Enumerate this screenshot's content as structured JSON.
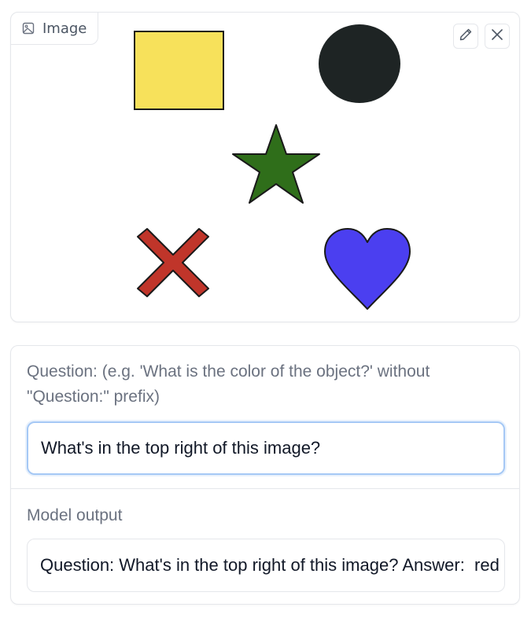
{
  "image_panel": {
    "badge_label": "Image",
    "badge_icon": "image-icon",
    "edit_icon": "pencil-icon",
    "close_icon": "close-icon",
    "shapes": [
      {
        "name": "yellow-square",
        "color": "#f7e15b"
      },
      {
        "name": "black-circle",
        "color": "#1e2424"
      },
      {
        "name": "green-star",
        "color": "#2f6e1a"
      },
      {
        "name": "red-x",
        "color": "#c0352a"
      },
      {
        "name": "blue-heart",
        "color": "#4b3ff0"
      }
    ]
  },
  "question": {
    "label": "Question: (e.g. 'What is the color of the object?' without \"Question:\" prefix)",
    "value": "What's in the top right of this image?"
  },
  "output": {
    "label": "Model output",
    "value": "Question: What's in the top right of this image? Answer:  red"
  },
  "colors": {
    "border": "#e5e7eb",
    "focus_border": "#a5c8f5",
    "label_text": "#6b7280"
  }
}
